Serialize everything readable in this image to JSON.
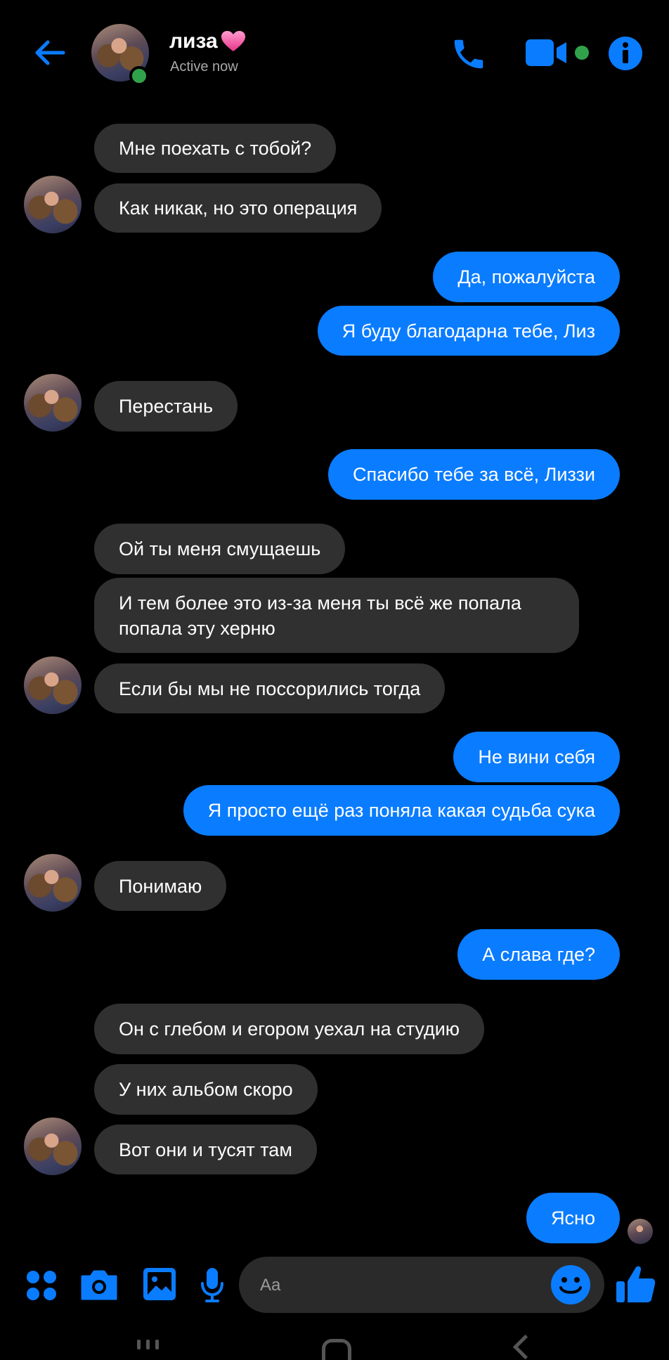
{
  "header": {
    "contact_name": "лиза",
    "status": "Active now",
    "icons": [
      "back-arrow-icon",
      "phone-icon",
      "video-camera-icon",
      "info-icon"
    ]
  },
  "messages": [
    {
      "from": "them",
      "text": "Мне поехать с тобой?"
    },
    {
      "from": "them",
      "text": "Как никак, но это операция"
    },
    {
      "from": "me",
      "text": "Да, пожалуйста"
    },
    {
      "from": "me",
      "text": "Я буду благодарна тебе, Лиз"
    },
    {
      "from": "them",
      "text": "Перестань"
    },
    {
      "from": "me",
      "text": "Спасибо тебе за всё, Лиззи"
    },
    {
      "from": "them",
      "text": "Ой ты меня смущаешь"
    },
    {
      "from": "them",
      "text": "И тем более это из-за меня ты всё же попала попала эту херню"
    },
    {
      "from": "them",
      "text": "Если бы мы не поссорились тогда"
    },
    {
      "from": "me",
      "text": "Не вини себя"
    },
    {
      "from": "me",
      "text": "Я просто ещё раз поняла какая судьба сука"
    },
    {
      "from": "them",
      "text": "Понимаю"
    },
    {
      "from": "me",
      "text": "А слава где?"
    },
    {
      "from": "them",
      "text": "Он с глебом и егором уехал на студию"
    },
    {
      "from": "them",
      "text": "У них альбом скоро"
    },
    {
      "from": "them",
      "text": "Вот они и тусят там"
    },
    {
      "from": "me",
      "text": "Ясно"
    }
  ],
  "composer": {
    "placeholder": "Aa"
  },
  "colors": {
    "accent": "#0a7cff",
    "incoming_bubble": "#303030",
    "background": "#000000",
    "online": "#31a24c"
  }
}
